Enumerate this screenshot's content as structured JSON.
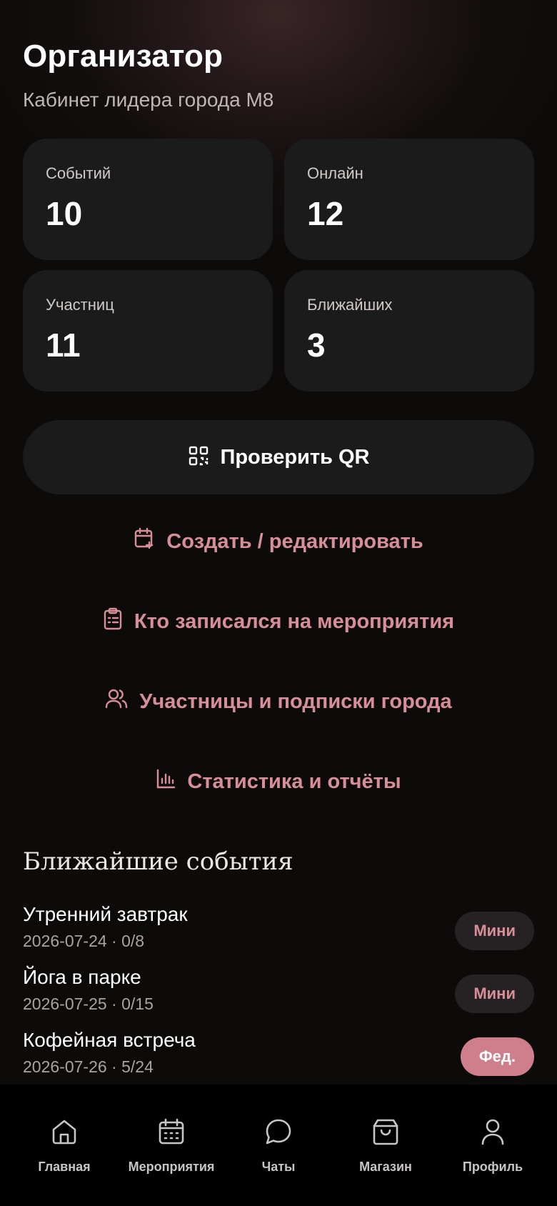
{
  "header": {
    "title": "Организатор",
    "subtitle": "Кабинет лидера города М8"
  },
  "stats": [
    {
      "label": "Событий",
      "value": "10"
    },
    {
      "label": "Онлайн",
      "value": "12"
    },
    {
      "label": "Участниц",
      "value": "11"
    },
    {
      "label": "Ближайших",
      "value": "3"
    }
  ],
  "qr_button": {
    "label": "Проверить QR",
    "icon": "qr-code-icon"
  },
  "actions": [
    {
      "label": "Создать / редактировать",
      "icon": "calendar-plus-icon"
    },
    {
      "label": "Кто записался на мероприятия",
      "icon": "clipboard-list-icon"
    },
    {
      "label": "Участницы и подписки города",
      "icon": "users-icon"
    },
    {
      "label": "Статистика и отчёты",
      "icon": "bar-chart-icon"
    }
  ],
  "upcoming": {
    "title": "Ближайшие события",
    "events": [
      {
        "name": "Утренний завтрак",
        "meta": "2026-07-24 · 0/8",
        "badge": "Мини"
      },
      {
        "name": "Йога в парке",
        "meta": "2026-07-25 · 0/15",
        "badge": "Мини"
      },
      {
        "name": "Кофейная встреча",
        "meta": "2026-07-26 · 5/24",
        "badge": "Фед."
      }
    ]
  },
  "nav": [
    {
      "label": "Главная",
      "icon": "home-icon"
    },
    {
      "label": "Мероприятия",
      "icon": "calendar-icon"
    },
    {
      "label": "Чаты",
      "icon": "chat-icon"
    },
    {
      "label": "Магазин",
      "icon": "shopping-bag-icon"
    },
    {
      "label": "Профиль",
      "icon": "user-icon"
    }
  ],
  "colors": {
    "background": "#0d0b0a",
    "card": "#1c1b1b",
    "accent": "#d88e98",
    "badge_fed": "#cf7f8c"
  }
}
